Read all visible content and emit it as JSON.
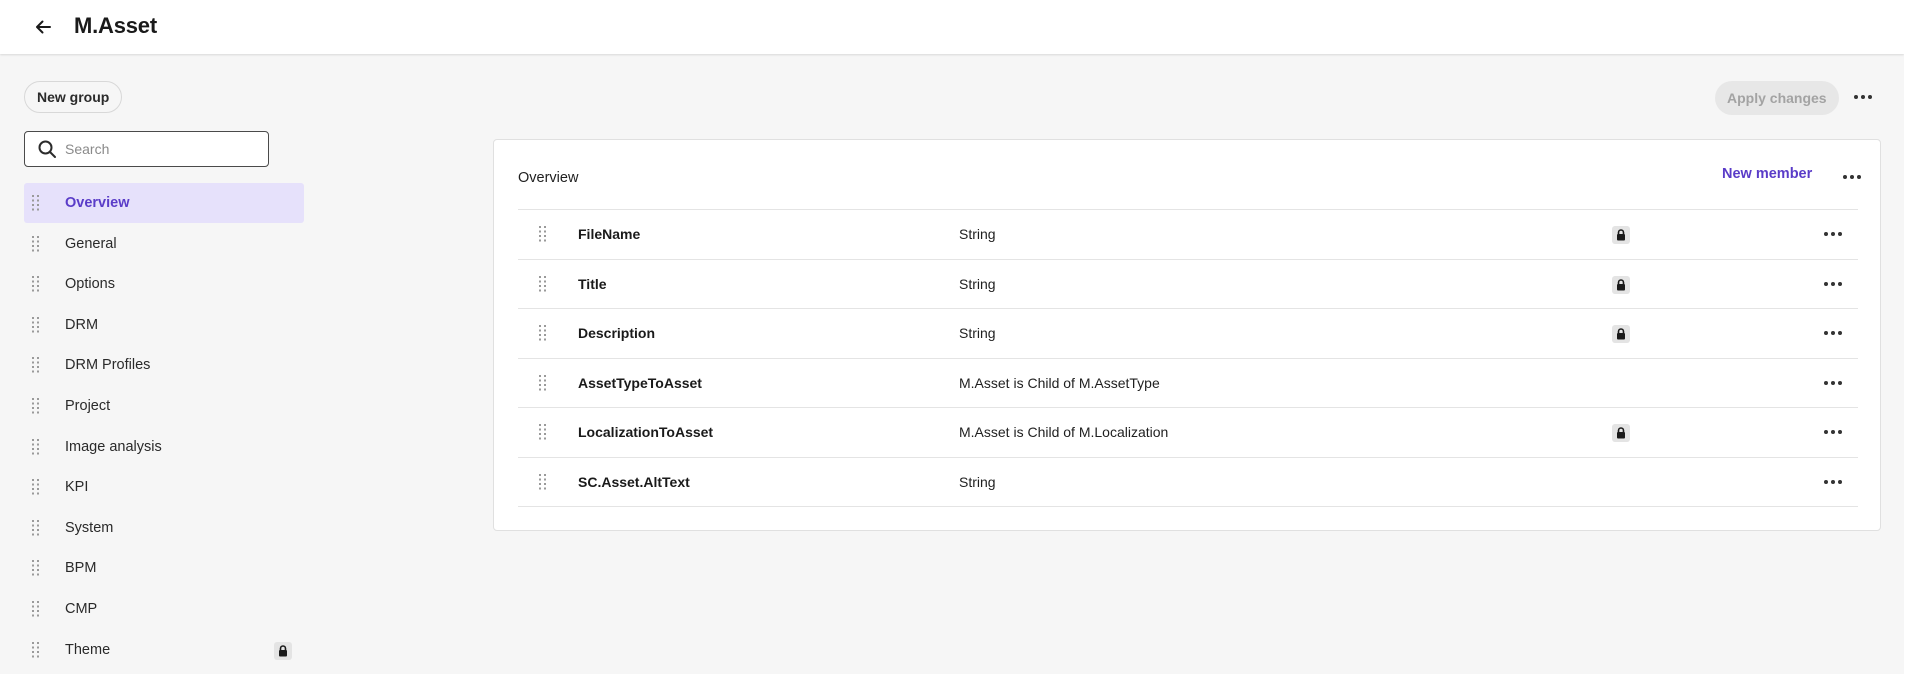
{
  "header": {
    "title": "M.Asset",
    "back_icon": "arrow-left-icon"
  },
  "sidebar": {
    "new_group_label": "New group",
    "search_placeholder": "Search",
    "items": [
      {
        "label": "Overview",
        "active": true,
        "locked": false
      },
      {
        "label": "General",
        "active": false,
        "locked": false
      },
      {
        "label": "Options",
        "active": false,
        "locked": false
      },
      {
        "label": "DRM",
        "active": false,
        "locked": false
      },
      {
        "label": "DRM Profiles",
        "active": false,
        "locked": false
      },
      {
        "label": "Project",
        "active": false,
        "locked": false
      },
      {
        "label": "Image analysis",
        "active": false,
        "locked": false
      },
      {
        "label": "KPI",
        "active": false,
        "locked": false
      },
      {
        "label": "System",
        "active": false,
        "locked": false
      },
      {
        "label": "BPM",
        "active": false,
        "locked": false
      },
      {
        "label": "CMP",
        "active": false,
        "locked": false
      },
      {
        "label": "Theme",
        "active": false,
        "locked": true
      }
    ]
  },
  "toolbar": {
    "apply_label": "Apply changes",
    "apply_disabled": true
  },
  "panel": {
    "title": "Overview",
    "new_member_label": "New member",
    "members": [
      {
        "name": "FileName",
        "type": "String",
        "locked": true
      },
      {
        "name": "Title",
        "type": "String",
        "locked": true
      },
      {
        "name": "Description",
        "type": "String",
        "locked": true
      },
      {
        "name": "AssetTypeToAsset",
        "type": "M.Asset is Child of M.AssetType",
        "locked": false
      },
      {
        "name": "LocalizationToAsset",
        "type": "M.Asset is Child of M.Localization",
        "locked": true
      },
      {
        "name": "SC.Asset.AltText",
        "type": "String",
        "locked": false
      }
    ]
  },
  "colors": {
    "accent": "#5a3cc8",
    "active_bg": "#e6e1fb",
    "background": "#f6f6f6"
  }
}
